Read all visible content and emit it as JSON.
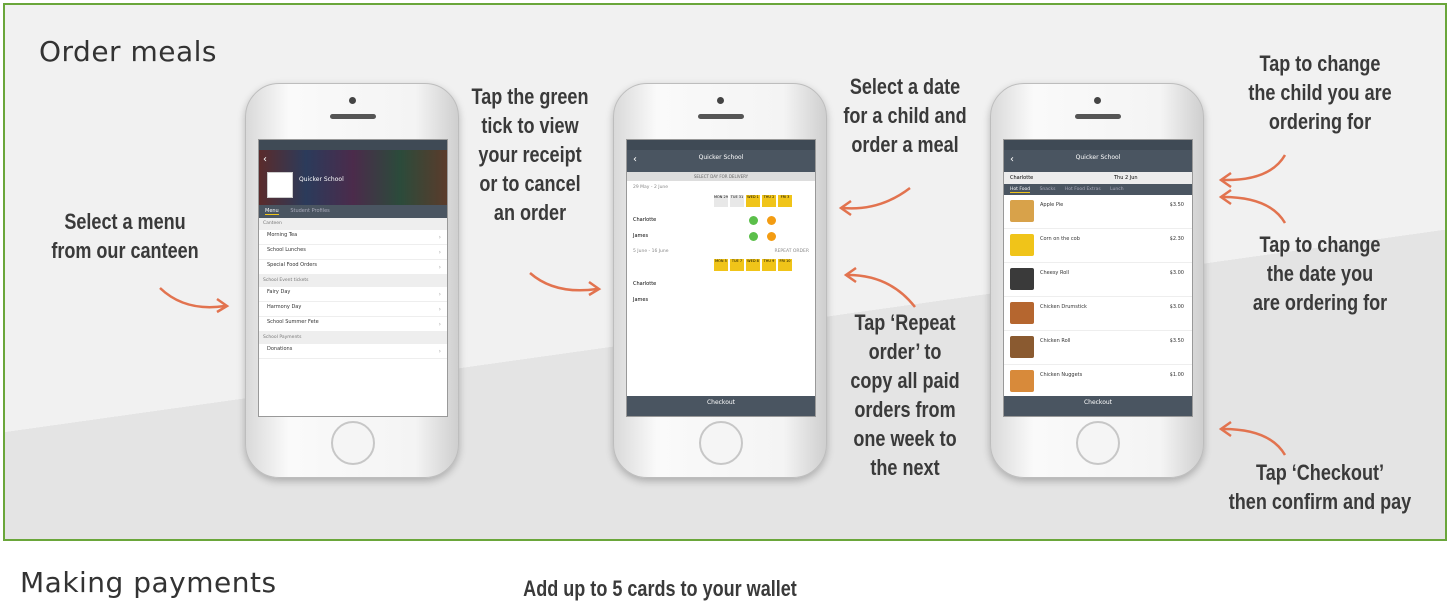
{
  "headings": {
    "order_meals": "Order meals",
    "making_payments": "Making payments"
  },
  "captions": {
    "select_menu": [
      "Select a menu",
      "from our canteen"
    ],
    "green_tick": [
      "Tap the green",
      "tick to view",
      "your receipt",
      "or to cancel",
      "an order"
    ],
    "select_date": [
      "Select a date",
      "for a child and",
      "order a meal"
    ],
    "repeat_order": [
      "Tap ‘Repeat",
      "order’ to",
      "copy all paid",
      "orders from",
      "one week to",
      "the next"
    ],
    "change_child": [
      "Tap to change",
      "the child you are",
      "ordering for"
    ],
    "change_date": [
      "Tap to change",
      "the date you",
      "are ordering for"
    ],
    "checkout": [
      "Tap ‘Checkout’",
      "then confirm and pay"
    ],
    "cards": "Add up to 5 cards to your wallet"
  },
  "phone1": {
    "school": "Quicker School",
    "tabs": [
      "Menu",
      "Student Profiles"
    ],
    "sections": [
      {
        "title": "Canteen",
        "items": [
          "Morning Tea",
          "School Lunches",
          "Special Food Orders"
        ]
      },
      {
        "title": "School Event tickets",
        "items": [
          "Fairy Day",
          "Harmony Day",
          "School Summer Fete"
        ]
      },
      {
        "title": "School Payments",
        "items": [
          "Donations"
        ]
      }
    ]
  },
  "phone2": {
    "school": "Quicker School",
    "subtitle": "SELECT DAY FOR DELIVERY",
    "week1": "29 May - 2 June",
    "week2": "5 June - 16 June",
    "repeat": "REPEAT ORDER",
    "days1": [
      "MON 29",
      "TUE 31",
      "WED 1",
      "THU 2",
      "FRI 3"
    ],
    "days2": [
      "MON 5",
      "TUE 7",
      "WED 8",
      "THU 9",
      "FRI 10"
    ],
    "children": [
      "Charlotte",
      "James"
    ],
    "checkout": "Checkout"
  },
  "phone3": {
    "school": "Quicker School",
    "child": "Charlotte",
    "date": "Thu 2 Jun",
    "tabs": [
      "Hot Food",
      "Snacks",
      "Hot Food Extras",
      "Lunch"
    ],
    "foods": [
      {
        "name": "Apple Pie",
        "price": "$3.50"
      },
      {
        "name": "Corn on the cob",
        "price": "$2.30"
      },
      {
        "name": "Cheesy Roll",
        "price": "$3.00"
      },
      {
        "name": "Chicken Drumstick",
        "price": "$3.00"
      },
      {
        "name": "Chicken Roll",
        "price": "$3.50"
      },
      {
        "name": "Chicken Nuggets",
        "price": "$1.00"
      }
    ],
    "checkout": "Checkout"
  },
  "colors": {
    "border": "#6aa63a",
    "arrow": "#e2734f",
    "accent": "#f0c419",
    "navbar": "#4a5561"
  }
}
